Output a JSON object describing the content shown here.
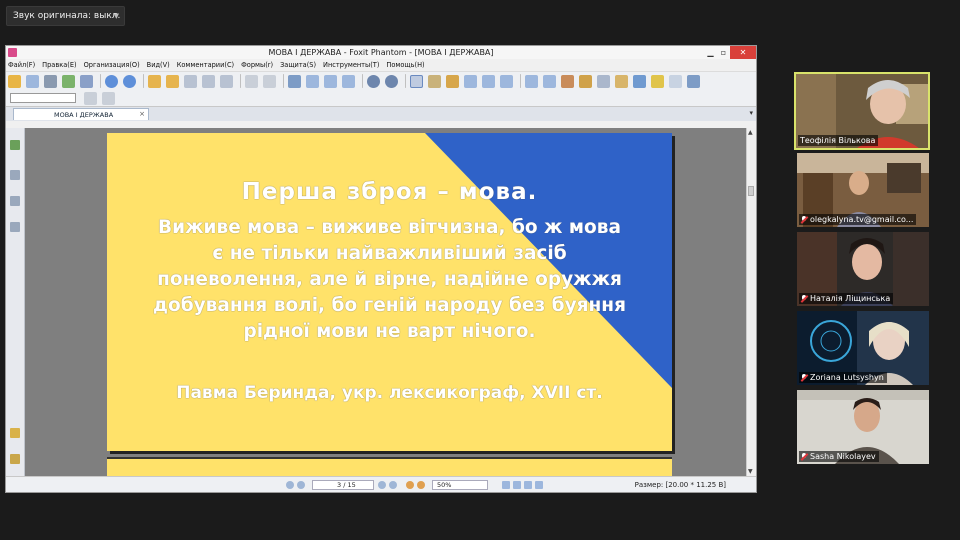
{
  "audio_control": {
    "label": "Звук оригинала: выкл."
  },
  "app": {
    "window_title": "МОВА І ДЕРЖАВА - Foxit Phantom - [МОВА І ДЕРЖАВА]",
    "menu": [
      "Файл(F)",
      "Правка(E)",
      "Организация(O)",
      "Вид(V)",
      "Комментарии(C)",
      "Формы(r)",
      "Защита(S)",
      "Инструменты(T)",
      "Помощь(H)"
    ],
    "tab_label": "МОВА І ДЕРЖАВА",
    "status": {
      "page": "3 / 15",
      "zoom": "50%",
      "size": "Размер: [20.00 * 11.25 В]"
    }
  },
  "slide": {
    "title": "Перша зброя – мова.",
    "body_lines": [
      "Виживе мова – виживе вітчизна, бо ж мова",
      "є не тільки найважливіший засіб",
      "поневолення, але й вірне, надійне оружжя",
      "добування волі, бо геній народу без буяння",
      "рідної мови не варт нічого."
    ],
    "attribution": "Павма Беринда, укр. лексикограф, XVII ст.",
    "colors": {
      "yellow": "#ffe26a",
      "blue": "#2f62c8"
    }
  },
  "participants": [
    {
      "name": "Теофілія Вількова",
      "active": true,
      "muted": false
    },
    {
      "name": "olegkalyna.tv@gmail.co...",
      "active": false,
      "muted": true
    },
    {
      "name": "Наталія Ліщинська",
      "active": false,
      "muted": true
    },
    {
      "name": "Zoriana Lutsyshyn",
      "active": false,
      "muted": true
    },
    {
      "name": "Sasha Nikolayev",
      "active": false,
      "muted": true
    }
  ]
}
